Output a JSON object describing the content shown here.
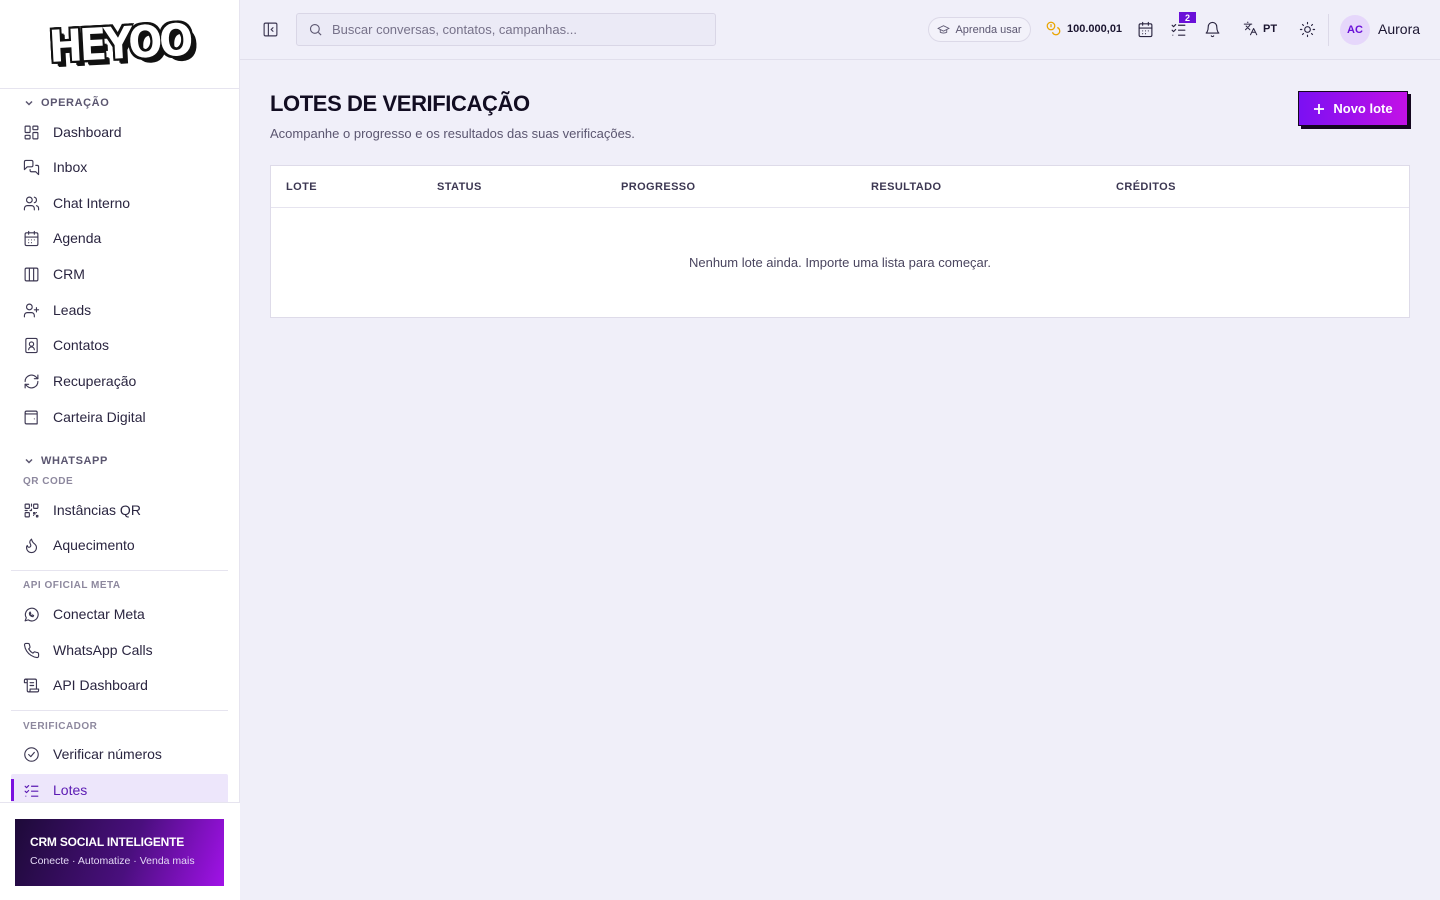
{
  "brand": {
    "logo_text": "HEYOO"
  },
  "sidebar": {
    "sections": {
      "operacao": "OPERAÇÃO",
      "whatsapp": "WHATSAPP",
      "qr_code": "QR CODE",
      "api_oficial": "API OFICIAL META",
      "verificador": "VERIFICADOR"
    },
    "items": [
      {
        "label": "Dashboard",
        "icon": "dashboard-icon"
      },
      {
        "label": "Inbox",
        "icon": "inbox-icon"
      },
      {
        "label": "Chat Interno",
        "icon": "users-icon"
      },
      {
        "label": "Agenda",
        "icon": "calendar-icon"
      },
      {
        "label": "CRM",
        "icon": "kanban-icon"
      },
      {
        "label": "Leads",
        "icon": "user-plus-icon"
      },
      {
        "label": "Contatos",
        "icon": "contact-book-icon"
      },
      {
        "label": "Recuperação",
        "icon": "refresh-icon"
      },
      {
        "label": "Carteira Digital",
        "icon": "wallet-icon"
      },
      {
        "label": "Instâncias QR",
        "icon": "qr-code-icon"
      },
      {
        "label": "Aquecimento",
        "icon": "flame-icon"
      },
      {
        "label": "Conectar Meta",
        "icon": "whatsapp-icon"
      },
      {
        "label": "WhatsApp Calls",
        "icon": "phone-icon"
      },
      {
        "label": "API Dashboard",
        "icon": "scroll-icon"
      },
      {
        "label": "Verificar números",
        "icon": "check-circle-icon"
      },
      {
        "label": "Lotes",
        "icon": "list-checks-icon",
        "active": true
      }
    ],
    "promo": {
      "title": "CRM SOCIAL INTELIGENTE",
      "subtitle": "Conecte · Automatize · Venda mais"
    }
  },
  "topbar": {
    "search_placeholder": "Buscar conversas, contatos, campanhas...",
    "learn_label": "Aprenda usar",
    "credits": "100.000,01",
    "tasks_badge": "2",
    "language": "PT",
    "user_initials": "AC",
    "user_name": "Aurora"
  },
  "main": {
    "title": "LOTES DE VERIFICAÇÃO",
    "subtitle": "Acompanhe o progresso e os resultados das suas verificações.",
    "new_button": "Novo lote",
    "table": {
      "columns": [
        "LOTE",
        "STATUS",
        "PROGRESSO",
        "RESULTADO",
        "CRÉDITOS"
      ],
      "empty_message": "Nenhum lote ainda. Importe uma lista para começar."
    }
  },
  "colors": {
    "accent": "#7b12e0",
    "accent_end": "#c311e6",
    "background": "#f0eff9",
    "credits_icon": "#e9a400"
  }
}
